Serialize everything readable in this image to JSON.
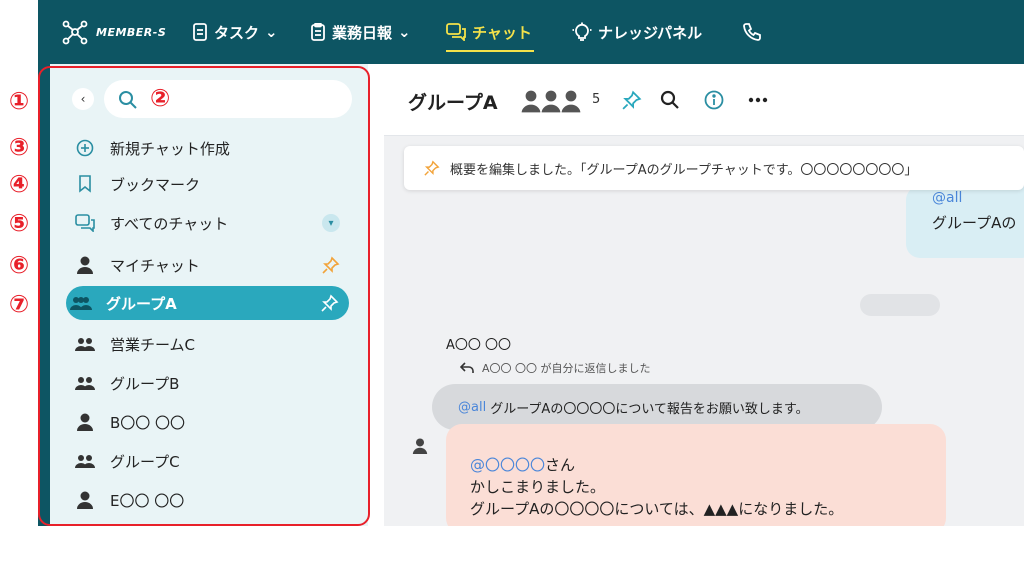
{
  "nav": {
    "logo": "MEMBER-S",
    "items": [
      {
        "label": "タスク",
        "icon": "task-icon"
      },
      {
        "label": "業務日報",
        "icon": "report-icon"
      },
      {
        "label": "チャット",
        "icon": "chat-icon"
      },
      {
        "label": "ナレッジパネル",
        "icon": "lightbulb-icon"
      }
    ],
    "phone_icon": "phone-icon",
    "active_color": "#f5e24a",
    "bar_color": "#0d5563"
  },
  "annotations": [
    "①",
    "②",
    "③",
    "④",
    "⑤",
    "⑥",
    "⑦"
  ],
  "sidebar": {
    "items": [
      {
        "label": "新規チャット作成",
        "icon": "plus-circle-icon"
      },
      {
        "label": "ブックマーク",
        "icon": "bookmark-icon"
      },
      {
        "label": "すべてのチャット",
        "icon": "chat-icon"
      },
      {
        "label": "マイチャット",
        "icon": "person-icon"
      },
      {
        "label": "グループA",
        "icon": "group-icon"
      },
      {
        "label": "営業チームC",
        "icon": "group-icon"
      },
      {
        "label": "グループB",
        "icon": "group-icon"
      },
      {
        "label": "B〇〇 〇〇",
        "icon": "person-icon"
      },
      {
        "label": "グループC",
        "icon": "group-icon"
      },
      {
        "label": "E〇〇 〇〇",
        "icon": "person-icon"
      }
    ],
    "selected_color": "#2aa8bd"
  },
  "header": {
    "title": "グループA",
    "member_count": "5"
  },
  "notice": "概要を編集しました。「グループAのグループチャットです。〇〇〇〇〇〇〇〇」",
  "right_bubble": {
    "mention": "@all",
    "text": "グループAの"
  },
  "message": {
    "sender": "A〇〇 〇〇",
    "reply_note": "A〇〇 〇〇 が自分に返信しました",
    "quote_mention": "@all",
    "quote_text": "グループAの〇〇〇〇について報告をお願い致します。",
    "mention": "@〇〇〇〇",
    "mention_suffix": "さん",
    "line1": "かしこまりました。",
    "line2": "グループAの〇〇〇〇については、▲▲▲になりました。"
  }
}
